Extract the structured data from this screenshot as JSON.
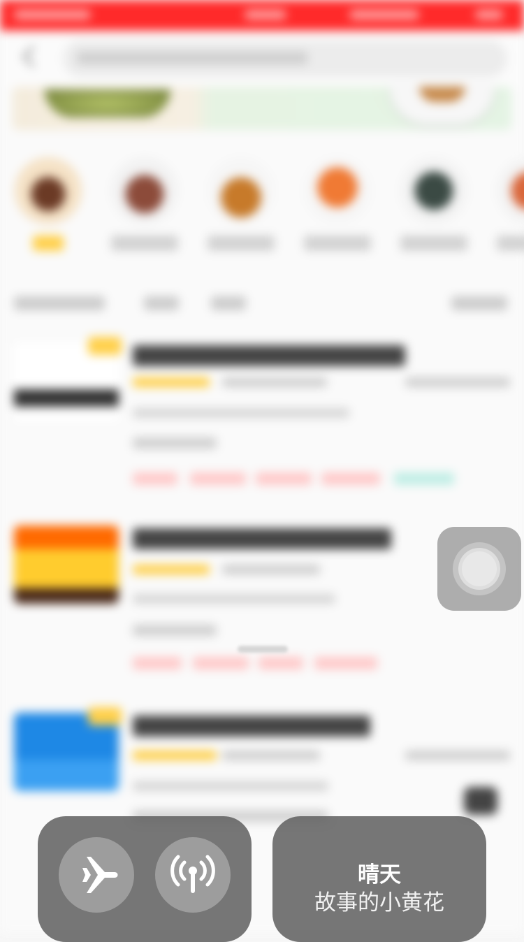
{
  "control_center": {
    "connectivity": {
      "airplane_mode": {
        "icon": "airplane-icon",
        "on": false
      },
      "cellular_data": {
        "icon": "cellular-antenna-icon",
        "on": false
      }
    },
    "now_playing": {
      "title": "晴天",
      "artist": "故事的小黄花"
    }
  },
  "colors": {
    "status_bar": "#ff2a2a",
    "panel": "#606060",
    "toggle": "#bebebe",
    "accent_yellow": "#ffd04a"
  }
}
